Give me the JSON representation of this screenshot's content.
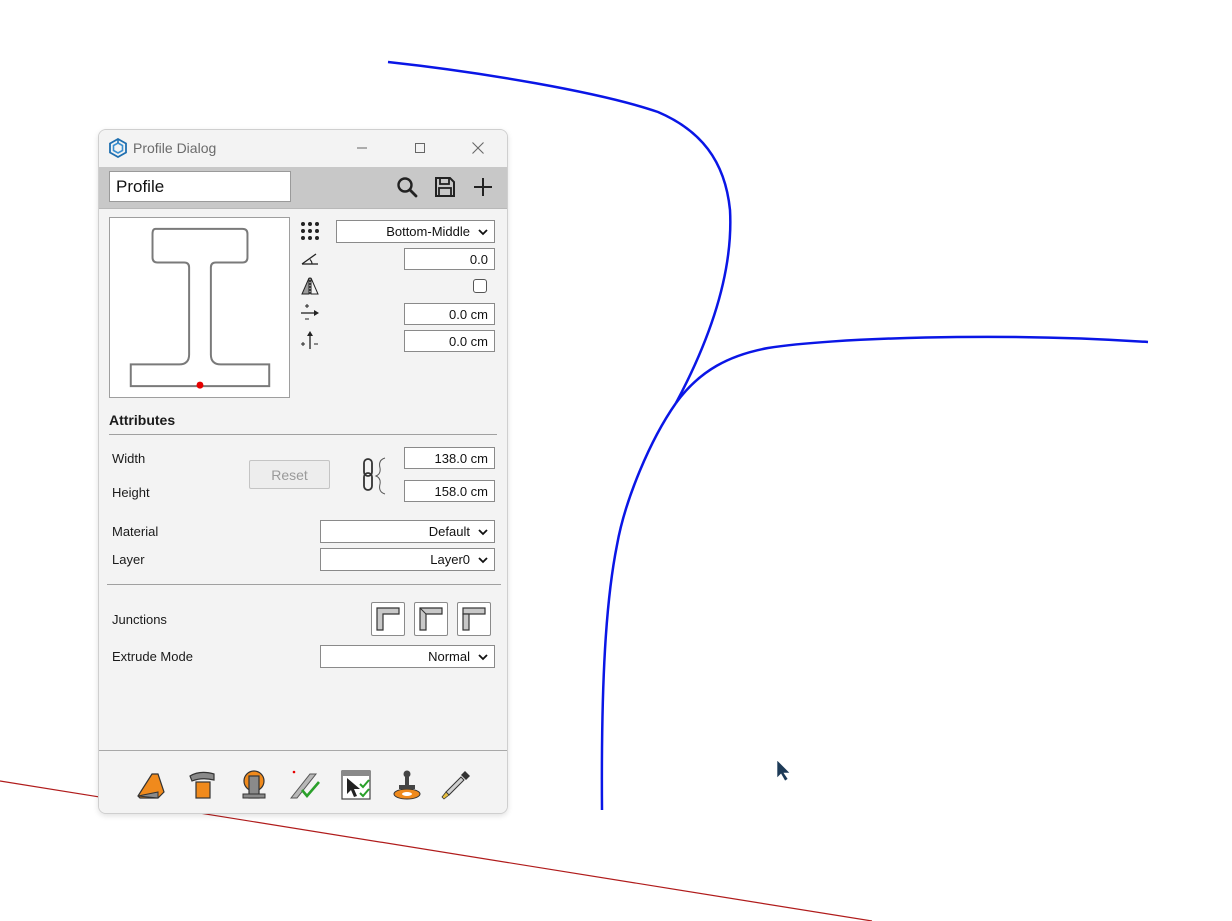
{
  "window": {
    "title": "Profile Dialog"
  },
  "toolbar": {
    "profile_name": "Profile",
    "icons": [
      "search-icon",
      "save-icon",
      "add-icon"
    ]
  },
  "placement": {
    "anchor": "Bottom-Middle",
    "rotation": "0.0",
    "mirror": false,
    "offset_x": "0.0 cm",
    "offset_y": "0.0 cm"
  },
  "attributes": {
    "heading": "Attributes",
    "width_label": "Width",
    "height_label": "Height",
    "width_value": "138.0 cm",
    "height_value": "158.0 cm",
    "reset_label": "Reset",
    "material_label": "Material",
    "material_value": "Default",
    "layer_label": "Layer",
    "layer_value": "Layer0"
  },
  "junctions": {
    "label": "Junctions",
    "extrude_label": "Extrude Mode",
    "extrude_value": "Normal"
  },
  "tools": [
    "extrude-tool-icon",
    "paint-tool-icon",
    "follow-me-tool-icon",
    "check-edges-tool-icon",
    "select-tool-icon",
    "stamp-tool-icon",
    "eyedropper-icon"
  ],
  "colors": {
    "curve": "#0a16e6",
    "axis": "#b01b1b",
    "anchor_point": "#e60000",
    "accent": "#f08a1c"
  }
}
